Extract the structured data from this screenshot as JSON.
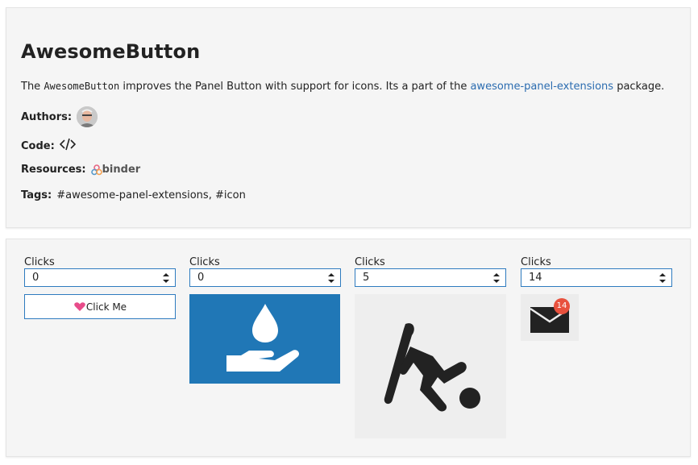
{
  "header": {
    "title": "AwesomeButton",
    "desc_pre": "The ",
    "desc_code": "AwesomeButton",
    "desc_mid": " improves the Panel Button with support for icons. Its a part of the ",
    "desc_link": "awesome-panel-extensions",
    "desc_post": " package."
  },
  "meta": {
    "authors_label": "Authors:",
    "code_label": "Code:",
    "resources_label": "Resources:",
    "resources_badge": "binder",
    "tags_label": "Tags:",
    "tags_value": "#awesome-panel-extensions, #icon"
  },
  "widgets": [
    {
      "label": "Clicks",
      "value": "0",
      "button_text": "Click Me",
      "icon": "heart-hand-icon"
    },
    {
      "label": "Clicks",
      "value": "0",
      "icon": "hand-holding-water-icon"
    },
    {
      "label": "Clicks",
      "value": "5",
      "icon": "snowboarding-icon"
    },
    {
      "label": "Clicks",
      "value": "14",
      "icon": "envelope-icon",
      "badge": "14"
    }
  ],
  "colors": {
    "accent": "#2e7bbf",
    "link": "#2b6cb0",
    "blue_button": "#2077b6",
    "badge": "#e8513d",
    "card_bg": "#f5f5f5"
  }
}
